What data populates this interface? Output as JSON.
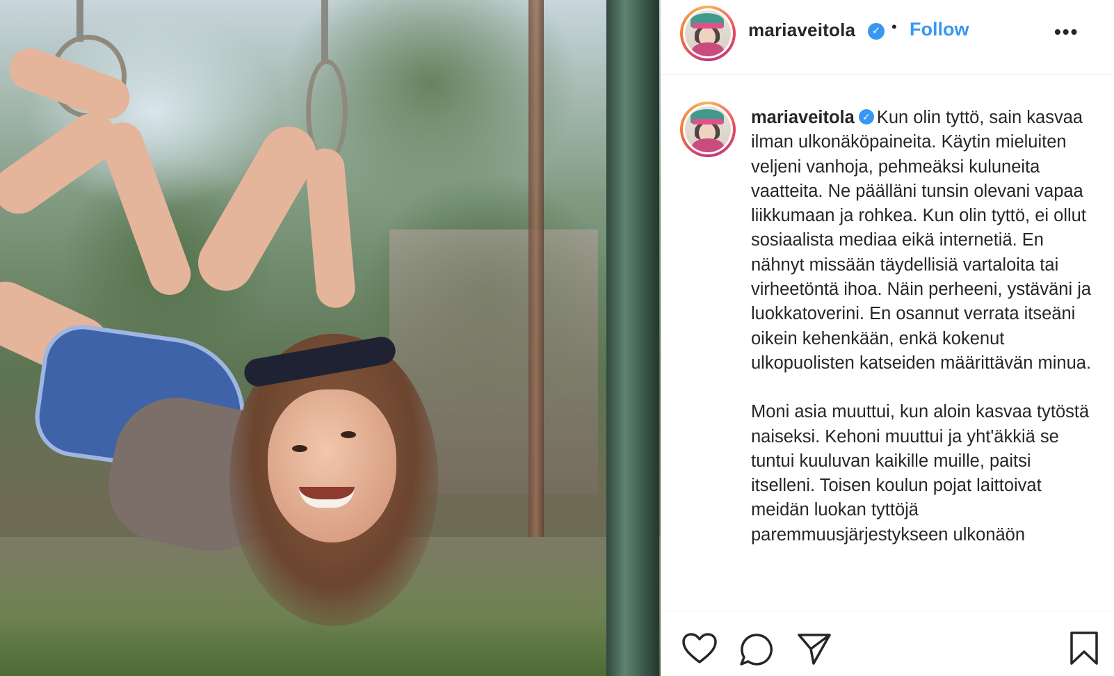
{
  "post": {
    "username": "mariaveitola",
    "verified_glyph": "✓",
    "separator": "•",
    "follow_label": "Follow",
    "more_label": "•••"
  },
  "caption": {
    "username": "mariaveitola",
    "paragraph_1": "Kun olin tyttö, sain kasvaa ilman ulkonäköpaineita. Käytin mieluiten veljeni vanhoja, pehmeäksi kuluneita vaatteita. Ne päälläni tunsin olevani vapaa liikkumaan ja rohkea. Kun olin tyttö, ei ollut sosiaalista mediaa eikä internetiä. En nähnyt missään täydellisiä vartaloita tai virheetöntä ihoa. Näin perheeni, ystäväni ja luokkatoverini. En osannut verrata itseäni oikein kehenkään, enkä kokenut ulkopuolisten katseiden määrittävän minua.",
    "paragraph_2": "Moni asia muuttui, kun aloin kasvaa tytöstä naiseksi. Kehoni muuttui ja yht'äkkiä se tuntui kuuluvan kaikille muille, paitsi itselleni. Toisen koulun pojat laittoivat meidän luokan tyttöjä paremmuusjärjestykseen ulkonäön"
  },
  "icons": {
    "like": "heart-icon",
    "comment": "comment-icon",
    "share": "share-icon",
    "save": "bookmark-icon",
    "verified": "verified-badge-icon",
    "more": "more-options-icon"
  },
  "colors": {
    "accent": "#3897f0",
    "text": "#262626",
    "divider": "#efefef",
    "story_ring": "#e64565"
  }
}
